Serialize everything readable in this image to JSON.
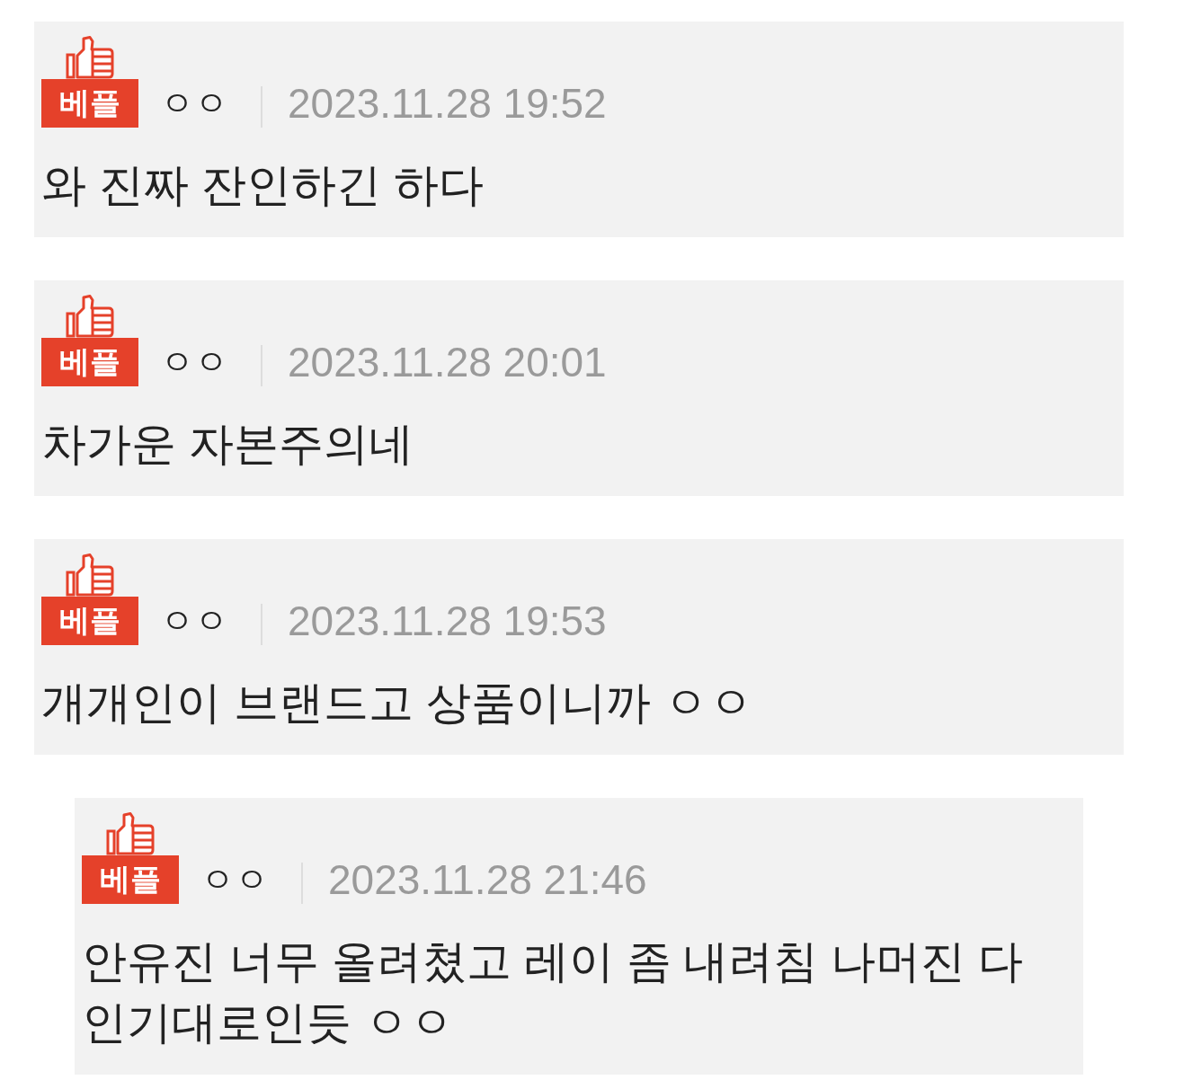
{
  "comments": [
    {
      "badge": "베플",
      "author": "ㅇㅇ",
      "date": "2023.11.28 19:52",
      "text": "와 진짜 잔인하긴 하다"
    },
    {
      "badge": "베플",
      "author": "ㅇㅇ",
      "date": "2023.11.28 20:01",
      "text": "차가운 자본주의네"
    },
    {
      "badge": "베플",
      "author": "ㅇㅇ",
      "date": "2023.11.28 19:53",
      "text": "개개인이 브랜드고 상품이니까 ㅇㅇ",
      "children": [
        {
          "badge": "베플",
          "author": "ㅇㅇ",
          "date": "2023.11.28 21:46",
          "text": "안유진 너무 올려쳤고 레이 좀 내려침 나머진 다 인기대로인듯 ㅇㅇ"
        }
      ]
    }
  ]
}
